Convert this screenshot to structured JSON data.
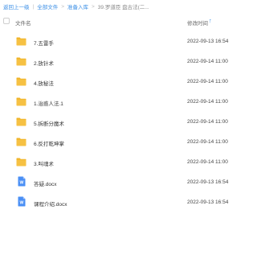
{
  "breadcrumb": {
    "back": "返回上一级",
    "separator": "|",
    "arrow": ">",
    "items": [
      "全部文件",
      "准备入库"
    ],
    "current": "39.罗道臣 盘古法(二..."
  },
  "header": {
    "name_label": "文件名",
    "time_label": "修改时间",
    "sort_arrow": "↑"
  },
  "files": [
    {
      "name": "7.五雷手",
      "time": "2022-09-13 16:54",
      "icon": "folder-icon"
    },
    {
      "name": "2.放针术",
      "time": "2022-09-14 11:00",
      "icon": "folder-icon"
    },
    {
      "name": "4.放秘法",
      "time": "2022-09-14 11:00",
      "icon": "folder-icon"
    },
    {
      "name": "1.治惑人法.1",
      "time": "2022-09-14 11:00",
      "icon": "folder-icon"
    },
    {
      "name": "5.拆断分魔术",
      "time": "2022-09-14 11:00",
      "icon": "folder-icon"
    },
    {
      "name": "6.反打乾坤掌",
      "time": "2022-09-14 11:00",
      "icon": "folder-icon"
    },
    {
      "name": "3.叫魂术",
      "time": "2022-09-14 11:00",
      "icon": "folder-icon"
    },
    {
      "name": "答疑.docx",
      "time": "2022-09-13 16:54",
      "icon": "word-doc-icon"
    },
    {
      "name": "课程介绍.docx",
      "time": "2022-09-13 16:54",
      "icon": "word-doc-icon"
    }
  ],
  "colors": {
    "link": "#3a8ee6",
    "folder": "#f6c143",
    "folder_tab": "#f0b429",
    "doc": "#4a8ff5"
  }
}
